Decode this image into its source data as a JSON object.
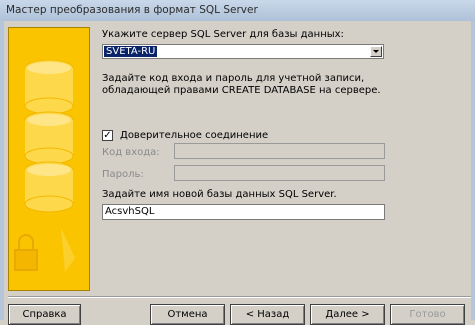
{
  "window": {
    "title": "Мастер преобразования в формат SQL Server"
  },
  "server": {
    "label": "Укажите сервер SQL Server для базы данных:",
    "selected": "SVETA-RU"
  },
  "login_note": {
    "line1": "Задайте код входа и пароль для учетной записи,",
    "line2": "обладающей правами CREATE DATABASE на сервере."
  },
  "trusted": {
    "label": "Доверительное соединение",
    "checked": "✓"
  },
  "login": {
    "label": "Код входа:",
    "value": ""
  },
  "password": {
    "label": "Пароль:",
    "value": ""
  },
  "database": {
    "label": "Задайте имя новой базы данных SQL Server.",
    "value": "AcsvhSQL"
  },
  "buttons": {
    "help": "Справка",
    "cancel": "Отмена",
    "back": "< Назад",
    "next": "Далее >",
    "finish": "Готово"
  },
  "colors": {
    "art_bg": "#fbc400",
    "window_bg": "#d4d0c8",
    "selection": "#0a246a"
  },
  "icons": {
    "art": "database-cylinders-icon",
    "lock": "lock-icon"
  }
}
